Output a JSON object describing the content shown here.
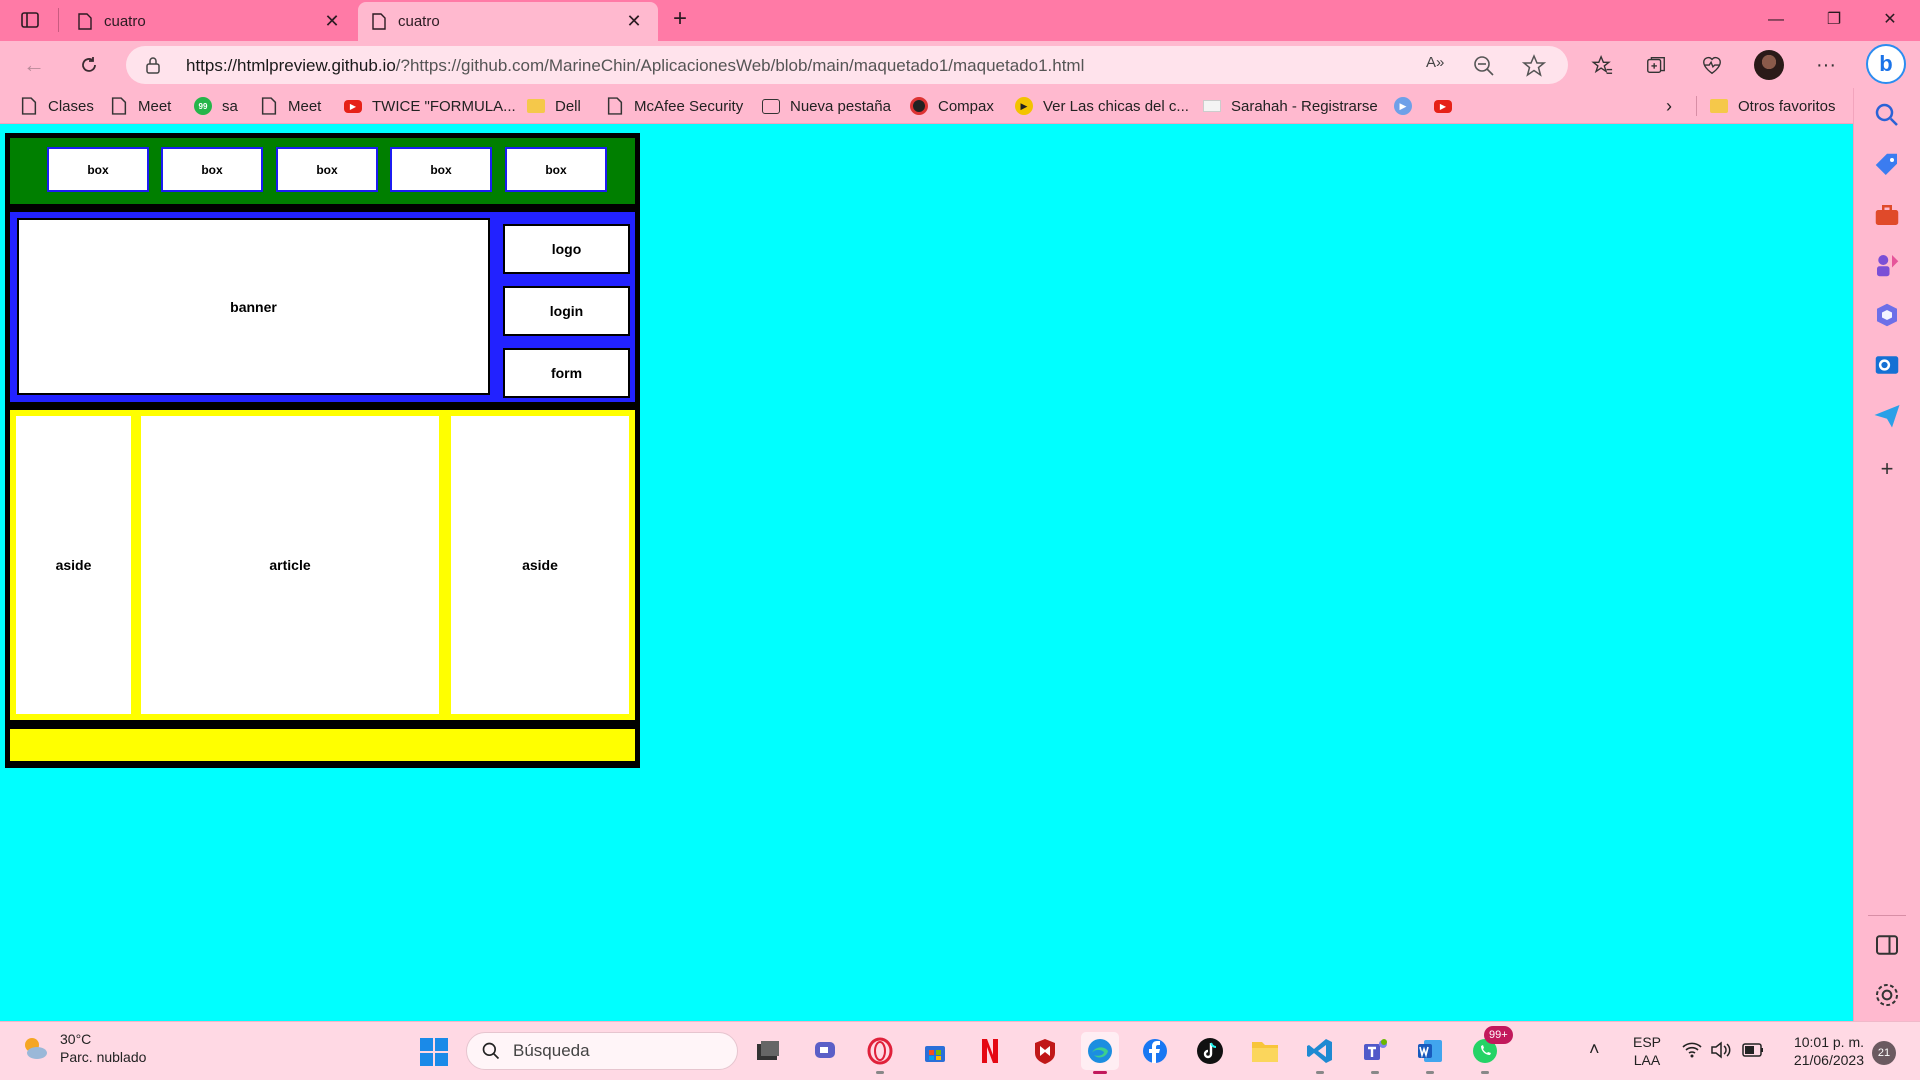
{
  "browser": {
    "tabs": [
      {
        "title": "cuatro",
        "active": false
      },
      {
        "title": "cuatro",
        "active": true
      }
    ],
    "new_tab_symbol": "+",
    "window_controls": {
      "minimize": "—",
      "restore": "❐",
      "close": "✕"
    },
    "url": {
      "host": "https://htmlpreview.github.io",
      "rest": "/?https://github.com/MarineChin/AplicacionesWeb/blob/main/maquetado1/maquetado1.html"
    },
    "bookmarks": [
      {
        "label": "Clases",
        "icon": "page-icon"
      },
      {
        "label": "Meet",
        "icon": "page-icon"
      },
      {
        "label": "sa",
        "icon": "badge-99-icon"
      },
      {
        "label": "Meet",
        "icon": "page-icon"
      },
      {
        "label": "TWICE \"FORMULA...",
        "icon": "youtube-icon"
      },
      {
        "label": "Dell",
        "icon": "folder-icon"
      },
      {
        "label": "McAfee Security",
        "icon": "page-icon"
      },
      {
        "label": "Nueva pestaña",
        "icon": "newtab-icon"
      },
      {
        "label": "Compax",
        "icon": "compax-icon"
      },
      {
        "label": "Ver Las chicas del c...",
        "icon": "play-icon"
      },
      {
        "label": "Sarahah - Registrarse",
        "icon": "mail-icon"
      },
      {
        "label": "",
        "icon": "blue-play-icon"
      },
      {
        "label": "",
        "icon": "youtube-icon"
      }
    ],
    "other_favorites": "Otros favoritos"
  },
  "page": {
    "header_boxes": [
      "box",
      "box",
      "box",
      "box",
      "box"
    ],
    "banner": "banner",
    "side_buttons": [
      "logo",
      "login",
      "form"
    ],
    "columns": [
      "aside",
      "article",
      "aside"
    ],
    "colors": {
      "background": "#00ffff",
      "container": "#000000",
      "header": "#007f00",
      "top_section": "#2222ff",
      "middle_section": "#ffff00",
      "footer": "#ffff00"
    }
  },
  "taskbar": {
    "weather": {
      "temp": "30°C",
      "desc": "Parc. nublado"
    },
    "search_placeholder": "Búsqueda",
    "whatsapp_badge": "99+",
    "lang": {
      "line1": "ESP",
      "line2": "LAA"
    },
    "time": "10:01 p. m.",
    "date": "21/06/2023",
    "notifications": "21"
  }
}
